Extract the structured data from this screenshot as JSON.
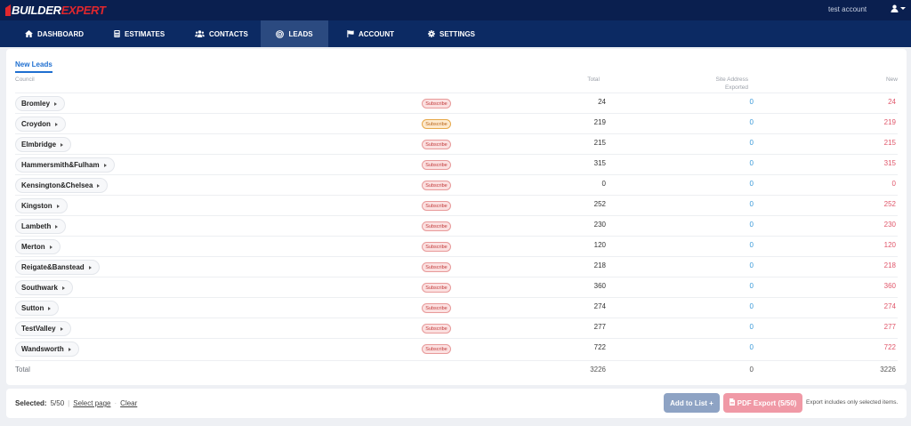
{
  "header": {
    "logo_builder": "BUILDER",
    "logo_expert": "EXPERT",
    "account_name": "test account"
  },
  "nav": {
    "dashboard": "DASHBOARD",
    "estimates": "ESTIMATES",
    "contacts": "CONTACTS",
    "leads": "LEADS",
    "account": "ACCOUNT",
    "settings": "SETTINGS"
  },
  "leads": {
    "tab_label": "New Leads",
    "columns": {
      "council": "Council",
      "total": "Total",
      "site_address_1": "Site Address",
      "site_address_2": "Exported",
      "new": "New"
    },
    "subscribe_label": "Subscribe",
    "rows": [
      {
        "council": "Bromley",
        "total": "24",
        "exported": "0",
        "new": "24"
      },
      {
        "council": "Croydon",
        "total": "219",
        "exported": "0",
        "new": "219"
      },
      {
        "council": "Elmbridge",
        "total": "215",
        "exported": "0",
        "new": "215"
      },
      {
        "council": "Hammersmith&Fulham",
        "total": "315",
        "exported": "0",
        "new": "315"
      },
      {
        "council": "Kensington&Chelsea",
        "total": "0",
        "exported": "0",
        "new": "0"
      },
      {
        "council": "Kingston",
        "total": "252",
        "exported": "0",
        "new": "252"
      },
      {
        "council": "Lambeth",
        "total": "230",
        "exported": "0",
        "new": "230"
      },
      {
        "council": "Merton",
        "total": "120",
        "exported": "0",
        "new": "120"
      },
      {
        "council": "Reigate&Banstead",
        "total": "218",
        "exported": "0",
        "new": "218"
      },
      {
        "council": "Southwark",
        "total": "360",
        "exported": "0",
        "new": "360"
      },
      {
        "council": "Sutton",
        "total": "274",
        "exported": "0",
        "new": "274"
      },
      {
        "council": "TestValley",
        "total": "277",
        "exported": "0",
        "new": "277"
      },
      {
        "council": "Wandsworth",
        "total": "722",
        "exported": "0",
        "new": "722"
      }
    ],
    "totals": {
      "label": "Total",
      "total": "3226",
      "exported": "0",
      "new": "3226"
    }
  },
  "footer": {
    "selected_label": "Selected:",
    "selected_value": "5/50",
    "select_page": "Select page",
    "dot": "·",
    "clear": "Clear",
    "add_to_list": "Add to List +",
    "pdf_export": "PDF Export (5/50)",
    "export_note": "Export includes only selected items."
  },
  "colors": {
    "topbar": "#0a1f4f",
    "navbar": "#0c2a63",
    "nav_active": "#2b4a80",
    "accent_blue": "#1f6fd0",
    "exported_blue": "#3a9ad9",
    "new_red": "#e0566a",
    "brand_red": "#e1272d"
  },
  "icons": {
    "dashboard": "home-icon",
    "estimates": "calculator-icon",
    "contacts": "users-icon",
    "leads": "target-icon",
    "account": "flag-icon",
    "settings": "gear-icon",
    "user": "user-icon",
    "pdf": "file-pdf-icon"
  }
}
